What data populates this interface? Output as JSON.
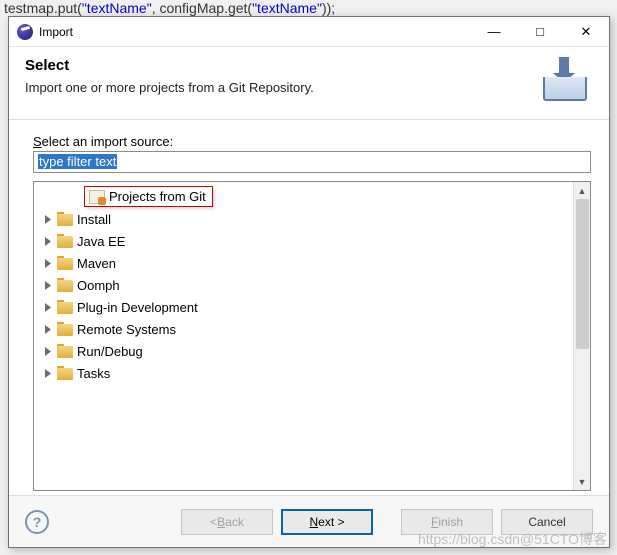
{
  "backdrop": {
    "code_prefix": "testmap",
    "code_method1": ".put(",
    "code_str1": "\"textName\"",
    "code_mid": ", configMap.get(",
    "code_str2": "\"textName\"",
    "code_end": "));"
  },
  "dialog": {
    "title": "Import",
    "banner": {
      "heading": "Select",
      "description": "Import one or more projects from a Git Repository."
    },
    "source_label_pre": "S",
    "source_label_post": "elect an import source:",
    "filter_text": "type filter text",
    "tooltip": "Projects from Git",
    "tree_items": [
      "Install",
      "Java EE",
      "Maven",
      "Oomph",
      "Plug-in Development",
      "Remote Systems",
      "Run/Debug",
      "Tasks"
    ],
    "buttons": {
      "back_pre": "< ",
      "back_u": "B",
      "back_post": "ack",
      "next_u": "N",
      "next_post": "ext >",
      "finish_u": "F",
      "finish_post": "inish",
      "cancel": "Cancel"
    }
  },
  "watermark": "https://blog.csdn@51CTO博客"
}
